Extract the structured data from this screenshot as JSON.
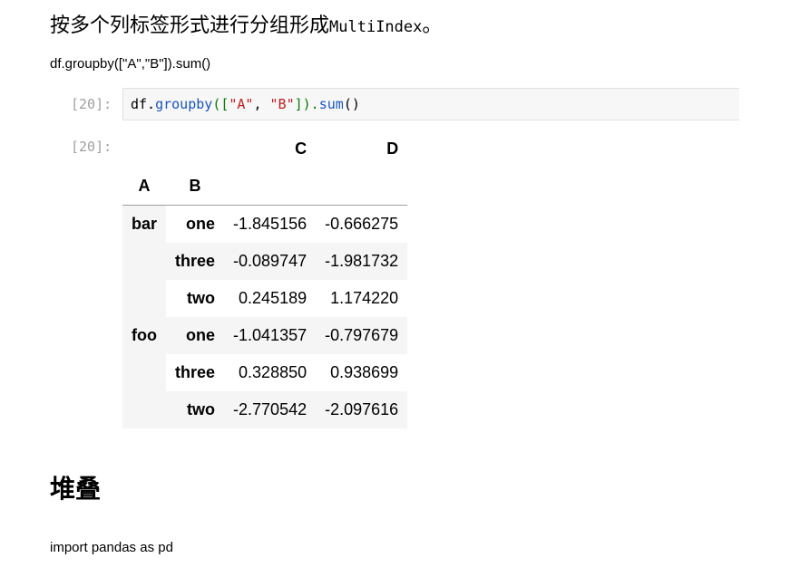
{
  "intro": {
    "text_cn": "按多个列标签形式进行分组形成",
    "text_code": "MultiIndex",
    "text_end": "。"
  },
  "caption": "df.groupby([\"A\",\"B\"]).sum()",
  "cell": {
    "in_prompt": "[20]:",
    "out_prompt": "[20]:",
    "code": {
      "p1": "df.",
      "fn": "groupby",
      "p2": "([",
      "s1": "\"A\"",
      "p3": ", ",
      "s2": "\"B\"",
      "p4": "]).",
      "fn2": "sum",
      "p5": "()"
    }
  },
  "table": {
    "columns": [
      "C",
      "D"
    ],
    "index_names": [
      "A",
      "B"
    ],
    "groups": [
      {
        "label": "bar",
        "rows": [
          {
            "b": "one",
            "c": "-1.845156",
            "d": "-0.666275"
          },
          {
            "b": "three",
            "c": "-0.089747",
            "d": "-1.981732"
          },
          {
            "b": "two",
            "c": "0.245189",
            "d": "1.174220"
          }
        ]
      },
      {
        "label": "foo",
        "rows": [
          {
            "b": "one",
            "c": "-1.041357",
            "d": "-0.797679"
          },
          {
            "b": "three",
            "c": "0.328850",
            "d": "0.938699"
          },
          {
            "b": "two",
            "c": "-2.770542",
            "d": "-2.097616"
          }
        ]
      }
    ]
  },
  "section_title": "堆叠",
  "footer_code": "import pandas as pd"
}
